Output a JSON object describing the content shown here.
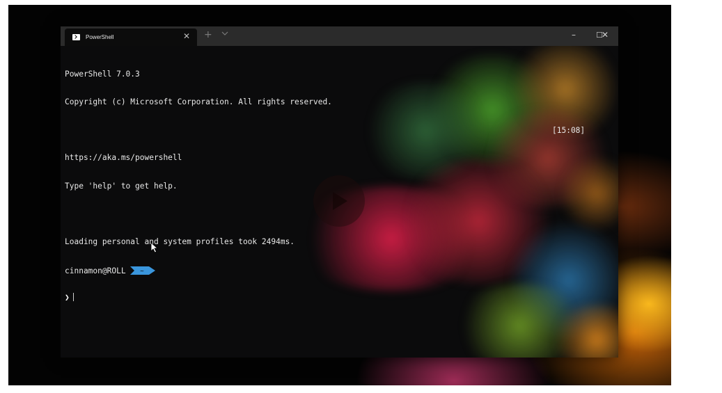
{
  "window": {
    "tab_title": "PowerShell",
    "tab_icon": "powershell-icon",
    "controls": {
      "minimize": "–",
      "maximize": "☐",
      "close": "✕"
    },
    "new_tab": "+",
    "tab_dropdown": "⌵"
  },
  "terminal": {
    "lines": [
      "PowerShell 7.0.3",
      "Copyright (c) Microsoft Corporation. All rights reserved.",
      "",
      "https://aka.ms/powershell",
      "Type 'help' to get help.",
      "",
      "Loading personal and system profiles took 2494ms."
    ],
    "prompt_user": "cinnamon@ROLL",
    "prompt_path": "~",
    "prompt_symbol": "❯",
    "clock": "[15:08]",
    "colors": {
      "prompt_arrow": "#3a96dd",
      "text": "#e8e8e8",
      "background": "#0c0c0c"
    }
  },
  "overlay": {
    "play_icon": "play-icon",
    "pointer_icon": "mouse-pointer-icon"
  }
}
